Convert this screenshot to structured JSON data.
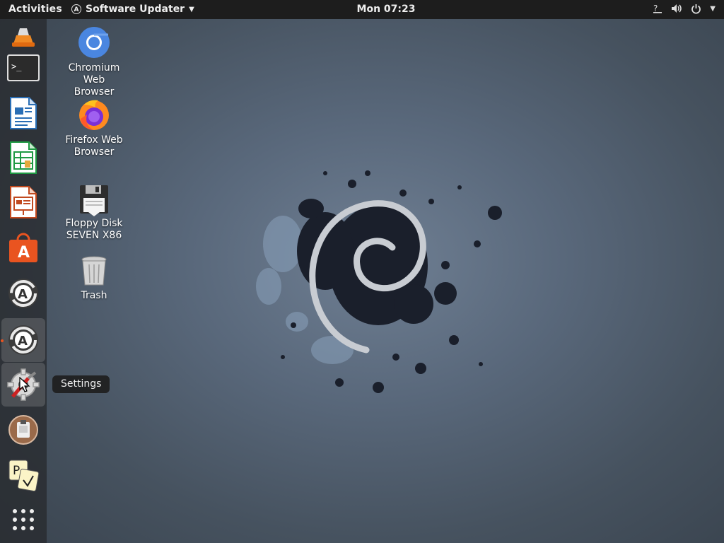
{
  "topbar": {
    "activities": "Activities",
    "app_menu": "Software Updater",
    "clock": "Mon 07:23",
    "tray_icons": [
      "accessibility-icon",
      "volume-icon",
      "power-icon",
      "tray-menu-caret-icon"
    ]
  },
  "dock": {
    "items": [
      {
        "name": "vlc-icon"
      },
      {
        "name": "terminal-icon"
      },
      {
        "name": "writer-icon"
      },
      {
        "name": "calc-icon"
      },
      {
        "name": "impress-icon"
      },
      {
        "name": "software-center-icon"
      },
      {
        "name": "software-updater-icon"
      },
      {
        "name": "software-updater-running-icon",
        "active": true
      },
      {
        "name": "settings-icon"
      },
      {
        "name": "archive-manager-icon"
      },
      {
        "name": "pdf-arranger-icon"
      },
      {
        "name": "show-applications-icon"
      }
    ],
    "tooltip": "Settings"
  },
  "desktop": {
    "chromium_label": "Chromium Web Browser",
    "firefox_label": "Firefox Web Browser",
    "floppy_label": "Floppy Disk SEVEN X86",
    "trash_label": "Trash"
  },
  "colors": {
    "topbar": "#1d1d1d",
    "accent": "#e95420",
    "background_center": "#6f7f93",
    "background_edge": "#3a444f"
  }
}
